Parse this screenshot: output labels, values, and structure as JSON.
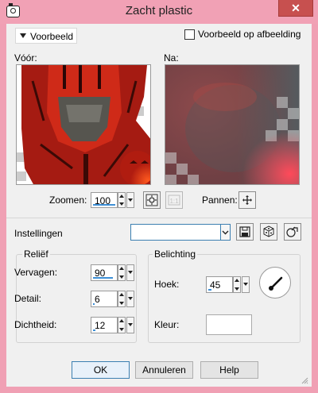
{
  "window": {
    "title": "Zacht plastic",
    "close_symbol": "✕"
  },
  "preview": {
    "toggle_label": "Voorbeeld",
    "checkbox_label": "Voorbeeld op afbeelding",
    "checkbox_checked": false,
    "before_label": "Vóór:",
    "after_label": "Na:",
    "zoom_label": "Zoomen:",
    "zoom_value": "100",
    "pan_label": "Pannen:"
  },
  "settings": {
    "label": "Instellingen",
    "preset_value": ""
  },
  "relief": {
    "title": "Reliëf",
    "fields": [
      {
        "label": "Vervagen:",
        "value": "90",
        "level": 0.9
      },
      {
        "label": "Detail:",
        "value": "6",
        "level": 0.06
      },
      {
        "label": "Dichtheid:",
        "value": "12",
        "level": 0.12
      }
    ]
  },
  "lighting": {
    "title": "Belichting",
    "angle_label": "Hoek:",
    "angle_value": "45",
    "angle_level": 0.125,
    "color_label": "Kleur:",
    "color_value": "#ffffff"
  },
  "buttons": {
    "ok": "OK",
    "cancel": "Annuleren",
    "help": "Help"
  },
  "colors": {
    "title_bar": "#f1a1b5",
    "close": "#c7504f",
    "accent": "#3d8fd6"
  }
}
